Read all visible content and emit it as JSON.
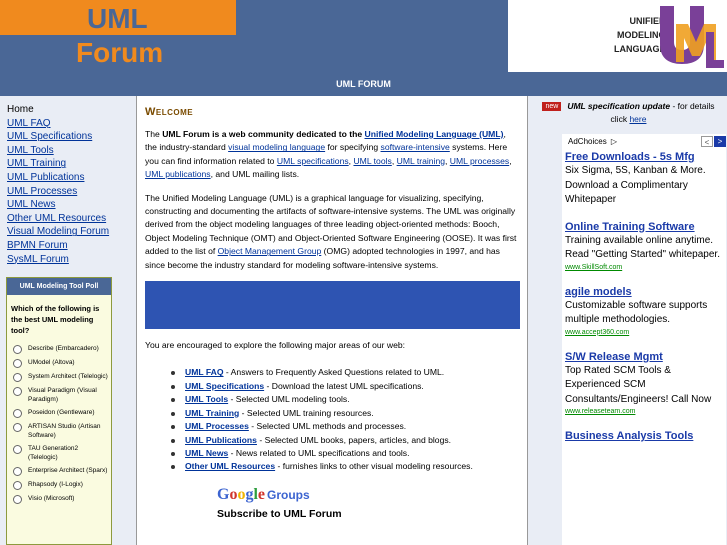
{
  "header": {
    "logo_uml": "UML",
    "logo_forum": "Forum",
    "omg_lines": [
      "UNIFIED",
      "MODELING",
      "LANGUAGE"
    ]
  },
  "titlebar": "UML FORUM",
  "nav": {
    "items": [
      "Home",
      "UML FAQ",
      "UML Specifications",
      "UML Tools",
      "UML Training",
      "UML Publications",
      "UML Processes",
      "UML News",
      "Other UML Resources",
      "Visual Modeling Forum",
      "BPMN Forum",
      "SysML Forum"
    ]
  },
  "poll": {
    "title": "UML Modeling Tool Poll",
    "question": "Which of the following is the best UML modeling tool?",
    "options": [
      "Describe (Embarcadero)",
      "UModel (Altova)",
      "System Architect (Telelogic)",
      "Visual Paradigm (Visual Paradigm)",
      "Poseidon (Gentleware)",
      "ARTISAN Studio (Artisan Software)",
      "TAU Generation2 (Telelogic)",
      "Enterprise Architect (Sparx)",
      "Rhapsody (I-Logix)",
      "Visio (Microsoft)"
    ]
  },
  "main": {
    "heading": "Welcome",
    "p1": {
      "t1": "The ",
      "bold": "UML Forum is a web community dedicated to the ",
      "link1": "Unified Modeling Language (UML)",
      "t2": ", the industry-standard ",
      "link2": "visual modeling language",
      "t3": " for specifying ",
      "link3": "software-intensive",
      "t4": " systems. Here you can find information related to ",
      "link4": "UML specifications",
      "t5": ", ",
      "link5": "UML tools",
      "t6": ", ",
      "link6": "UML training",
      "t7": ", ",
      "link7": "UML processes",
      "t8": ", ",
      "link8": "UML publications",
      "t9": ", and UML mailing lists."
    },
    "p2": {
      "t1": "The Unified Modeling Language (UML) is a graphical language for visualizing, specifying, constructing and documenting the artifacts of software-intensive systems. The UML was originally derived from the object modeling languages of three leading object-oriented methods: Booch, Object Modeling Technique (OMT) and Object-Oriented Software Engineering (OOSE). It was first added to the list of ",
      "link": "Object Management Group",
      "t2": " (OMG) adopted technologies in 1997, and has since become the industry standard for modeling software-intensive systems."
    },
    "p3": "You are encouraged to explore the following major areas of our web:",
    "links": [
      {
        "label": "UML FAQ",
        "desc": " - Answers to Frequently Asked Questions related to UML."
      },
      {
        "label": "UML Specifications",
        "desc": " - Download the latest UML specifications."
      },
      {
        "label": "UML Tools",
        "desc": " - Selected UML modeling tools."
      },
      {
        "label": "UML Training",
        "desc": " - Selected UML training resources."
      },
      {
        "label": "UML Processes",
        "desc": " - Selected UML methods and processes."
      },
      {
        "label": "UML Publications",
        "desc": " - Selected UML books, papers, articles, and blogs."
      },
      {
        "label": "UML News",
        "desc": " - News related to UML specifications and tools."
      },
      {
        "label": "Other UML Resources",
        "desc": " - furnishes links to other visual modeling resources."
      }
    ],
    "google_letters": [
      "G",
      "o",
      "o",
      "g",
      "l",
      "e"
    ],
    "google_groups": "Groups",
    "subscribe": "Subscribe to UML Forum"
  },
  "right": {
    "new_badge": "new",
    "spec_bold": "UML specification update",
    "spec_text": " - for details click ",
    "spec_link": "here",
    "adchoices": "AdChoices",
    "ads": [
      {
        "title": "Free Downloads - 5s Mfg",
        "body": "Six Sigma, 5S, Kanban & More. Download a Complimentary Whitepaper",
        "url": ""
      },
      {
        "title": "Online Training Software",
        "body": "Training available online anytime. Read \"Getting Started\" whitepaper.",
        "url": "www.SkillSoft.com"
      },
      {
        "title": "agile models",
        "body": "Customizable software supports multiple methodologies.",
        "url": "www.accept360.com"
      },
      {
        "title": "S/W Release Mgmt",
        "body": "Top Rated SCM Tools & Experienced SCM Consultants/Engineers! Call Now",
        "url": "www.releaseteam.com"
      },
      {
        "title": "Business Analysis Tools",
        "body": "",
        "url": ""
      }
    ]
  },
  "colors": {
    "brand_blue": "#4a6796",
    "brand_orange": "#f08a1e",
    "banner_blue": "#2e54b2"
  }
}
